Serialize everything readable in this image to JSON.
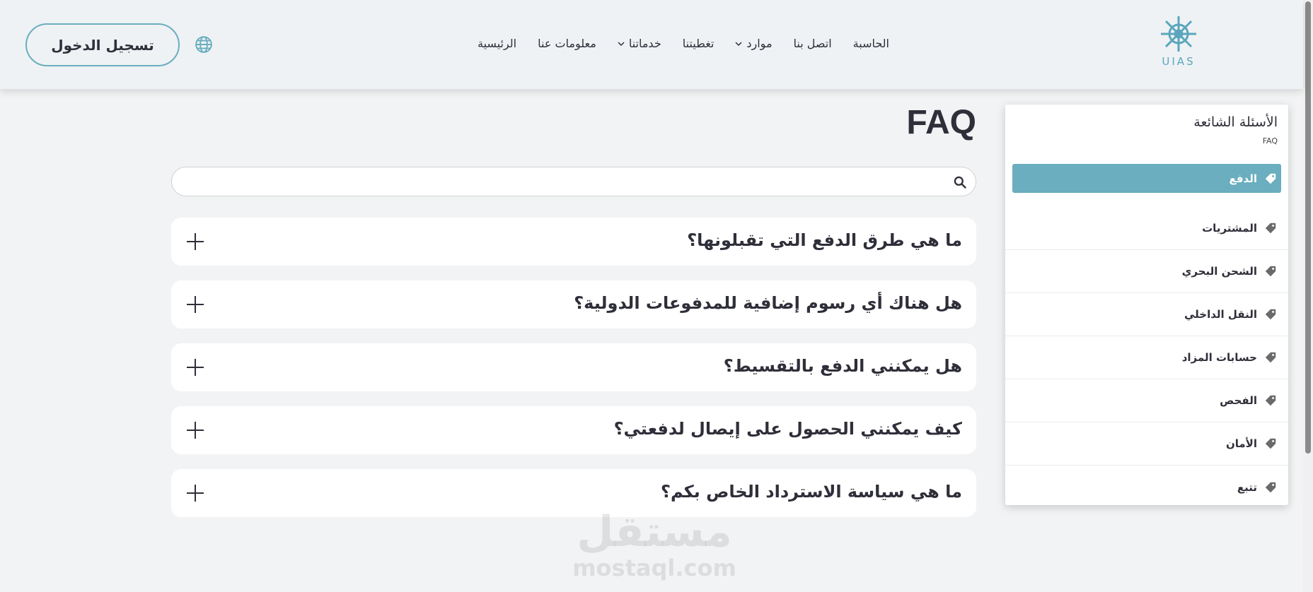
{
  "header": {
    "login_label": "تسجيل الدخول",
    "language_icon": "globe-icon",
    "logo_text": "UIAS",
    "nav": [
      {
        "label": "الرئيسية",
        "dropdown": false
      },
      {
        "label": "معلومات عنا",
        "dropdown": false
      },
      {
        "label": "خدماتنا",
        "dropdown": true
      },
      {
        "label": "تغطيتنا",
        "dropdown": false
      },
      {
        "label": "موارد",
        "dropdown": true
      },
      {
        "label": "اتصل بنا",
        "dropdown": false
      },
      {
        "label": "الحاسبة",
        "dropdown": false
      }
    ]
  },
  "sidebar": {
    "title": "الأسئلة الشائعة",
    "subtitle": "FAQ",
    "items": [
      {
        "label": "الدفع",
        "active": true
      },
      {
        "label": "المشتريات",
        "active": false
      },
      {
        "label": "الشحن البحري",
        "active": false
      },
      {
        "label": "النقل الداخلي",
        "active": false
      },
      {
        "label": "حسابات المزاد",
        "active": false
      },
      {
        "label": "الفحص",
        "active": false
      },
      {
        "label": "الأمان",
        "active": false
      },
      {
        "label": "تتبع",
        "active": false
      }
    ]
  },
  "main": {
    "title": "FAQ",
    "search_placeholder": "",
    "questions": [
      "ما هي طرق الدفع التي تقبلونها؟",
      "هل هناك أي رسوم إضافية للمدفوعات الدولية؟",
      "هل يمكنني الدفع بالتقسيط؟",
      "كيف يمكنني الحصول على إيصال لدفعتي؟",
      "ما هي سياسة الاسترداد الخاص بكم؟"
    ]
  },
  "watermark": {
    "arabic": "مستقل",
    "latin": "mostaql.com"
  },
  "colors": {
    "accent": "#6aaebf",
    "text": "#2f2f3a",
    "background": "#f1f3f4"
  }
}
